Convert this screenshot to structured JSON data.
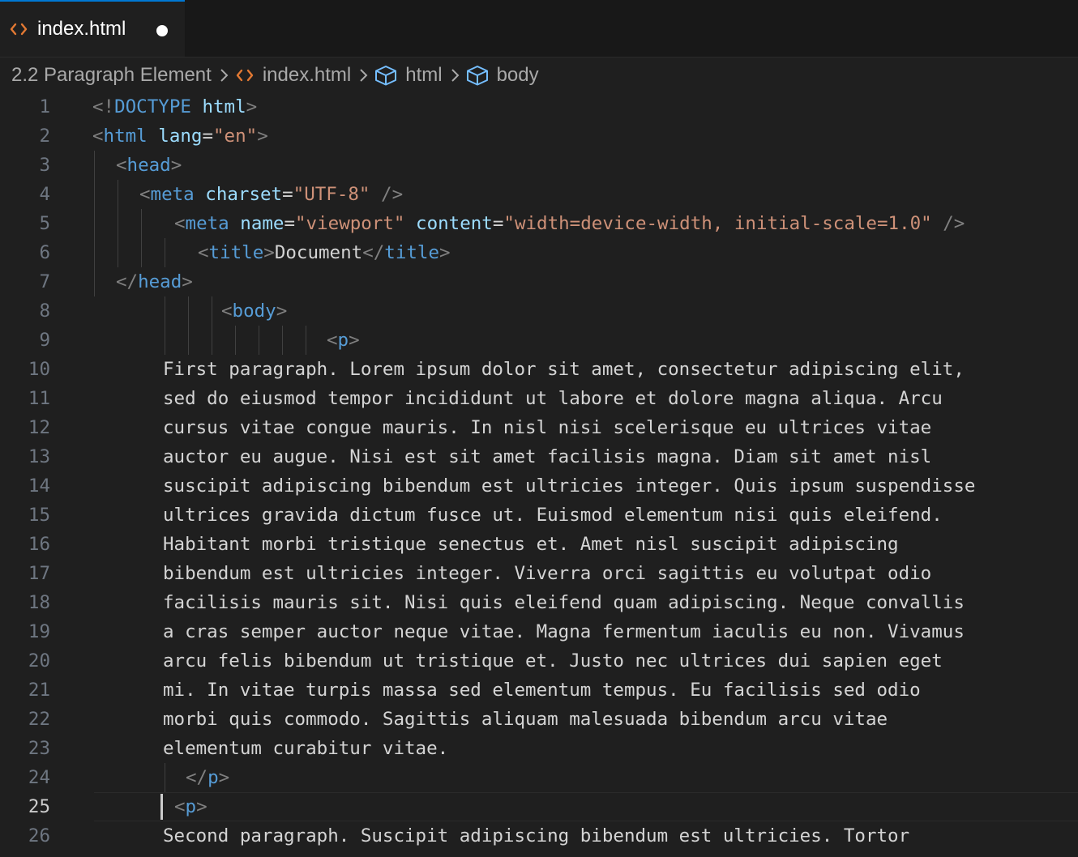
{
  "tab": {
    "label": "index.html",
    "icon": "html-file-icon",
    "modified": true
  },
  "breadcrumb": {
    "folder": "2.2 Paragraph Element",
    "file": "index.html",
    "html": "html",
    "body": "body"
  },
  "editor": {
    "current_line": 25,
    "lines": [
      {
        "n": "1",
        "tokens": [
          [
            "punc",
            "<!"
          ],
          [
            "tag",
            "DOCTYPE"
          ],
          [
            "text",
            " "
          ],
          [
            "attr",
            "html"
          ],
          [
            "punc",
            ">"
          ]
        ]
      },
      {
        "n": "2",
        "tokens": [
          [
            "punc",
            "<"
          ],
          [
            "tag",
            "html"
          ],
          [
            "text",
            " "
          ],
          [
            "attr",
            "lang"
          ],
          [
            "text",
            "="
          ],
          [
            "str",
            "\"en\""
          ],
          [
            "punc",
            ">"
          ]
        ]
      },
      {
        "n": "3",
        "tokens": [
          [
            "punc",
            "<"
          ],
          [
            "tag",
            "head"
          ],
          [
            "punc",
            ">"
          ]
        ]
      },
      {
        "n": "4",
        "tokens": [
          [
            "punc",
            "<"
          ],
          [
            "tag",
            "meta"
          ],
          [
            "text",
            " "
          ],
          [
            "attr",
            "charset"
          ],
          [
            "text",
            "="
          ],
          [
            "str",
            "\"UTF-8\""
          ],
          [
            "text",
            " "
          ],
          [
            "punc",
            "/>"
          ]
        ]
      },
      {
        "n": "5",
        "tokens": [
          [
            "punc",
            "<"
          ],
          [
            "tag",
            "meta"
          ],
          [
            "text",
            " "
          ],
          [
            "attr",
            "name"
          ],
          [
            "text",
            "="
          ],
          [
            "str",
            "\"viewport\""
          ],
          [
            "text",
            " "
          ],
          [
            "attr",
            "content"
          ],
          [
            "text",
            "="
          ],
          [
            "str",
            "\"width=device-width, initial-scale=1.0\""
          ],
          [
            "text",
            " "
          ],
          [
            "punc",
            "/>"
          ]
        ]
      },
      {
        "n": "6",
        "tokens": [
          [
            "punc",
            "<"
          ],
          [
            "tag",
            "title"
          ],
          [
            "punc",
            ">"
          ],
          [
            "text",
            "Document"
          ],
          [
            "punc",
            "</"
          ],
          [
            "tag",
            "title"
          ],
          [
            "punc",
            ">"
          ]
        ]
      },
      {
        "n": "7",
        "tokens": [
          [
            "punc",
            "</"
          ],
          [
            "tag",
            "head"
          ],
          [
            "punc",
            ">"
          ]
        ]
      },
      {
        "n": "8",
        "tokens": [
          [
            "punc",
            "<"
          ],
          [
            "tag",
            "body"
          ],
          [
            "punc",
            ">"
          ]
        ]
      },
      {
        "n": "9",
        "tokens": [
          [
            "punc",
            "<"
          ],
          [
            "tag",
            "p"
          ],
          [
            "punc",
            ">"
          ]
        ]
      },
      {
        "n": "10",
        "tokens": [
          [
            "text",
            "First paragraph. Lorem ipsum dolor sit amet, consectetur adipiscing elit,"
          ]
        ]
      },
      {
        "n": "11",
        "tokens": [
          [
            "text",
            "sed do eiusmod tempor incididunt ut labore et dolore magna aliqua. Arcu"
          ]
        ]
      },
      {
        "n": "12",
        "tokens": [
          [
            "text",
            "cursus vitae congue mauris. In nisl nisi scelerisque eu ultrices vitae"
          ]
        ]
      },
      {
        "n": "13",
        "tokens": [
          [
            "text",
            "auctor eu augue. Nisi est sit amet facilisis magna. Diam sit amet nisl"
          ]
        ]
      },
      {
        "n": "14",
        "tokens": [
          [
            "text",
            "suscipit adipiscing bibendum est ultricies integer. Quis ipsum suspendisse"
          ]
        ]
      },
      {
        "n": "15",
        "tokens": [
          [
            "text",
            "ultrices gravida dictum fusce ut. Euismod elementum nisi quis eleifend."
          ]
        ]
      },
      {
        "n": "16",
        "tokens": [
          [
            "text",
            "Habitant morbi tristique senectus et. Amet nisl suscipit adipiscing"
          ]
        ]
      },
      {
        "n": "17",
        "tokens": [
          [
            "text",
            "bibendum est ultricies integer. Viverra orci sagittis eu volutpat odio"
          ]
        ]
      },
      {
        "n": "18",
        "tokens": [
          [
            "text",
            "facilisis mauris sit. Nisi quis eleifend quam adipiscing. Neque convallis"
          ]
        ]
      },
      {
        "n": "19",
        "tokens": [
          [
            "text",
            "a cras semper auctor neque vitae. Magna fermentum iaculis eu non. Vivamus"
          ]
        ]
      },
      {
        "n": "20",
        "tokens": [
          [
            "text",
            "arcu felis bibendum ut tristique et. Justo nec ultrices dui sapien eget"
          ]
        ]
      },
      {
        "n": "21",
        "tokens": [
          [
            "text",
            "mi. In vitae turpis massa sed elementum tempus. Eu facilisis sed odio"
          ]
        ]
      },
      {
        "n": "22",
        "tokens": [
          [
            "text",
            "morbi quis commodo. Sagittis aliquam malesuada bibendum arcu vitae"
          ]
        ]
      },
      {
        "n": "23",
        "tokens": [
          [
            "text",
            "elementum curabitur vitae."
          ]
        ]
      },
      {
        "n": "24",
        "tokens": [
          [
            "punc",
            "</"
          ],
          [
            "tag",
            "p"
          ],
          [
            "punc",
            ">"
          ]
        ]
      },
      {
        "n": "25",
        "tokens": [
          [
            "punc",
            "<"
          ],
          [
            "tag",
            "p"
          ],
          [
            "punc",
            ">"
          ]
        ]
      },
      {
        "n": "26",
        "tokens": [
          [
            "text",
            "Second paragraph. Suscipit adipiscing bibendum est ultricies. Tortor"
          ]
        ]
      }
    ]
  }
}
